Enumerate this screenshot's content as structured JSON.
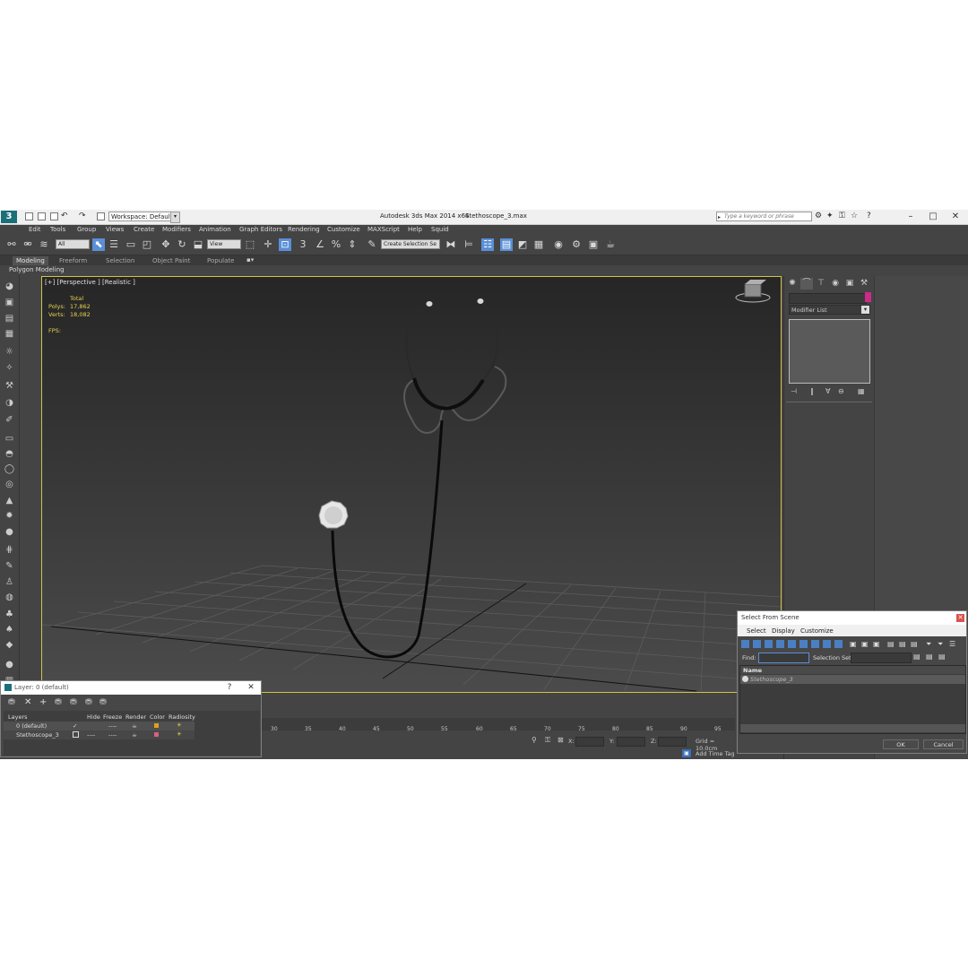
{
  "window": {
    "app_title": "Autodesk 3ds Max  2014 x64",
    "file_title": "Stethoscope_3.max",
    "workspace": "Workspace: Default",
    "search_placeholder": "Type a keyword or phrase",
    "logo": "3"
  },
  "menu": [
    "Edit",
    "Tools",
    "Group",
    "Views",
    "Create",
    "Modifiers",
    "Animation",
    "Graph Editors",
    "Rendering",
    "Customize",
    "MAXScript",
    "Help",
    "Squid"
  ],
  "toolbar": {
    "filter": "All",
    "coord_system": "View",
    "selection_set": "Create Selection Se"
  },
  "ribbon": {
    "tabs": [
      "Modeling",
      "Freeform",
      "Selection",
      "Object Paint",
      "Populate"
    ],
    "active_tab": "Modeling",
    "sub_label": "Polygon Modeling"
  },
  "viewport": {
    "label": "[+] [Perspective ] [Realistic ]",
    "stats_header": "Total",
    "polys_label": "Polys:",
    "polys_value": "17,862",
    "verts_label": "Verts:",
    "verts_value": "18,082",
    "fps_label": "FPS:"
  },
  "command_panel": {
    "modifier_list": "Modifier List",
    "object_color": "#cc2a8a"
  },
  "timeline": {
    "ticks": [
      "30",
      "35",
      "40",
      "45",
      "50",
      "55",
      "60",
      "65",
      "70",
      "75",
      "80",
      "85",
      "90",
      "95"
    ]
  },
  "status": {
    "x_label": "X:",
    "y_label": "Y:",
    "z_label": "Z:",
    "grid": "Grid = 10.0cm",
    "add_time_tag": "Add Time Tag"
  },
  "layer_dialog": {
    "title": "Layer: 0 (default)",
    "columns": [
      "Layers",
      "Hide",
      "Freeze",
      "Render",
      "Color",
      "Radiosity"
    ],
    "rows": [
      {
        "name": "0 (default)",
        "hide": "✓",
        "freeze": "----",
        "render": "☕",
        "color": "#e0a020",
        "radiosity": "☀"
      },
      {
        "name": "Stethoscope_3",
        "hide": "----",
        "freeze": "----",
        "render": "☕",
        "color": "#d86080",
        "radiosity": "☀"
      }
    ]
  },
  "select_dialog": {
    "title": "Select From Scene",
    "menu": [
      "Select",
      "Display",
      "Customize"
    ],
    "find_label": "Find:",
    "selection_set_label": "Selection Set:",
    "column_name": "Name",
    "items": [
      "Stethoscope_3"
    ],
    "ok": "OK",
    "cancel": "Cancel"
  }
}
